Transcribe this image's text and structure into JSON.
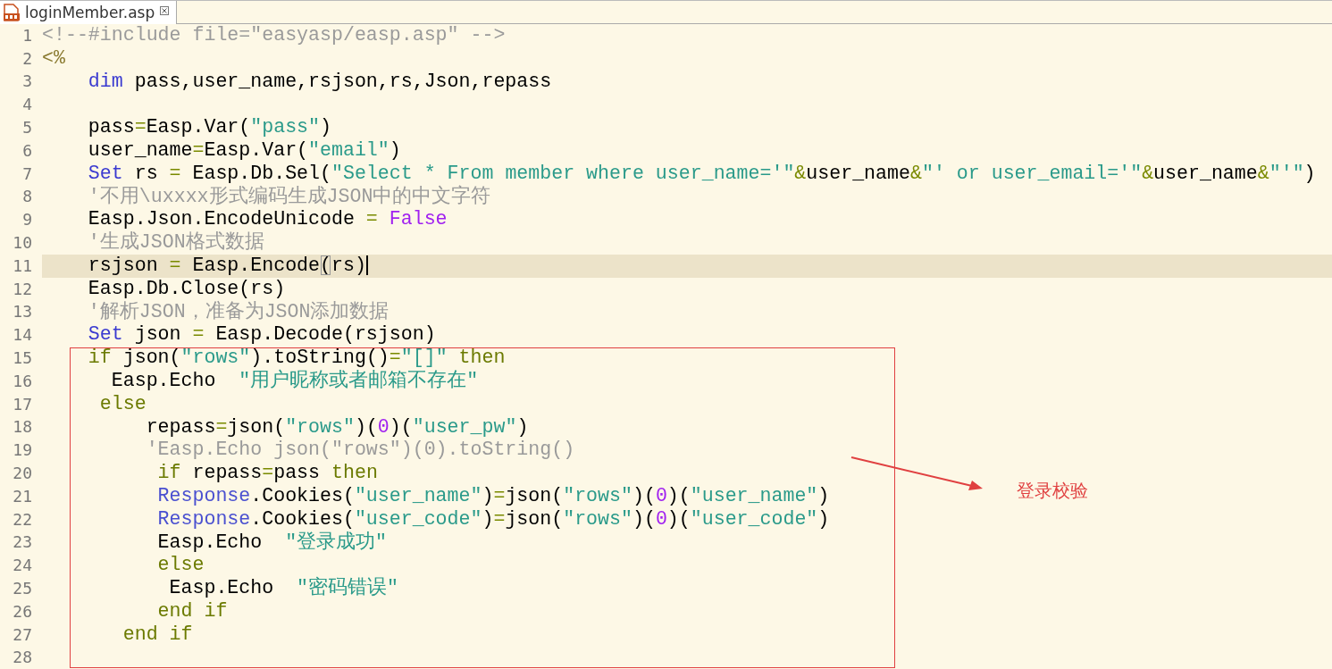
{
  "tabs": [
    {
      "label": "loginMember.asp",
      "selected": true
    }
  ],
  "lines": [
    {
      "number": "1",
      "current": false,
      "code": [
        {
          "text": "<!--#include file=\"easyasp/easp.asp\" -->",
          "kind": "comment"
        }
      ]
    },
    {
      "number": "2",
      "current": false,
      "code": [
        {
          "text": "<%",
          "kind": "tag"
        }
      ]
    },
    {
      "number": "3",
      "current": false,
      "code": [
        {
          "text": "    dim",
          "kind": "keyword"
        },
        {
          "text": " pass,user_name,rsjson,rs,Json,repass",
          "kind": "plain"
        }
      ]
    },
    {
      "number": "4",
      "current": false
    },
    {
      "number": "5",
      "current": false,
      "code": [
        {
          "text": "    pass",
          "kind": "plain"
        },
        {
          "text": "=",
          "kind": "operator"
        },
        {
          "text": "Easp.Var(",
          "kind": "plain"
        },
        {
          "text": "\"pass\"",
          "kind": "string"
        },
        {
          "text": ")",
          "kind": "plain"
        }
      ]
    },
    {
      "number": "6",
      "current": false,
      "code": [
        {
          "text": "    user_name",
          "kind": "plain"
        },
        {
          "text": "=",
          "kind": "operator"
        },
        {
          "text": "Easp.Var(",
          "kind": "plain"
        },
        {
          "text": "\"email\"",
          "kind": "string"
        },
        {
          "text": ")",
          "kind": "plain"
        }
      ]
    },
    {
      "number": "7",
      "current": false,
      "code": [
        {
          "text": "    Set",
          "kind": "keyword"
        },
        {
          "text": " rs ",
          "kind": "plain"
        },
        {
          "text": "=",
          "kind": "operator"
        },
        {
          "text": " Easp.Db.Sel(",
          "kind": "plain"
        },
        {
          "text": "\"Select * From member where user_name='\"",
          "kind": "string"
        },
        {
          "text": "&",
          "kind": "operator"
        },
        {
          "text": "user_name",
          "kind": "plain"
        },
        {
          "text": "&",
          "kind": "operator"
        },
        {
          "text": "\"' or user_email='\"",
          "kind": "string"
        },
        {
          "text": "&",
          "kind": "operator"
        },
        {
          "text": "user_name",
          "kind": "plain"
        },
        {
          "text": "&",
          "kind": "operator"
        },
        {
          "text": "\"'\"",
          "kind": "string"
        },
        {
          "text": ")",
          "kind": "plain"
        }
      ]
    },
    {
      "number": "8",
      "current": false,
      "code": [
        {
          "text": "    '不用\\uxxxx形式编码生成JSON中的中文字符",
          "kind": "comment"
        }
      ]
    },
    {
      "number": "9",
      "current": false,
      "code": [
        {
          "text": "    Easp.Json.EncodeUnicode ",
          "kind": "plain"
        },
        {
          "text": "=",
          "kind": "operator"
        },
        {
          "text": " False",
          "kind": "constant"
        }
      ]
    },
    {
      "number": "10",
      "current": false,
      "code": [
        {
          "text": "    '生成JSON格式数据",
          "kind": "comment"
        }
      ]
    },
    {
      "number": "11",
      "current": true,
      "code": [
        {
          "text": "    rsjson ",
          "kind": "plain"
        },
        {
          "text": "=",
          "kind": "operator"
        },
        {
          "text": " Easp.Encode",
          "kind": "plain"
        },
        {
          "text": "(",
          "kind": "match"
        },
        {
          "text": "rs)",
          "kind": "plain"
        }
      ]
    },
    {
      "number": "12",
      "current": false,
      "code": [
        {
          "text": "    Easp.Db.Close(rs)",
          "kind": "plain"
        }
      ]
    },
    {
      "number": "13",
      "current": false,
      "code": [
        {
          "text": "    '解析JSON，准备为JSON添加数据",
          "kind": "comment"
        }
      ]
    },
    {
      "number": "14",
      "current": false,
      "code": [
        {
          "text": "    Set",
          "kind": "keyword"
        },
        {
          "text": " json ",
          "kind": "plain"
        },
        {
          "text": "=",
          "kind": "operator"
        },
        {
          "text": " Easp.Decode(rsjson)",
          "kind": "plain"
        }
      ]
    },
    {
      "number": "15",
      "current": false,
      "code": [
        {
          "text": "    if",
          "kind": "control"
        },
        {
          "text": " json(",
          "kind": "plain"
        },
        {
          "text": "\"rows\"",
          "kind": "string"
        },
        {
          "text": ").toString()",
          "kind": "plain"
        },
        {
          "text": "=",
          "kind": "operator"
        },
        {
          "text": "\"[]\"",
          "kind": "string"
        },
        {
          "text": " then",
          "kind": "control"
        }
      ]
    },
    {
      "number": "16",
      "current": false,
      "code": [
        {
          "text": "      Easp.Echo  ",
          "kind": "plain"
        },
        {
          "text": "\"用户昵称或者邮箱不存在\"",
          "kind": "string"
        }
      ]
    },
    {
      "number": "17",
      "current": false,
      "code": [
        {
          "text": "     else",
          "kind": "control"
        }
      ]
    },
    {
      "number": "18",
      "current": false,
      "code": [
        {
          "text": "         repass",
          "kind": "plain"
        },
        {
          "text": "=",
          "kind": "operator"
        },
        {
          "text": "json(",
          "kind": "plain"
        },
        {
          "text": "\"rows\"",
          "kind": "string"
        },
        {
          "text": ")(",
          "kind": "plain"
        },
        {
          "text": "0",
          "kind": "number"
        },
        {
          "text": ")(",
          "kind": "plain"
        },
        {
          "text": "\"user_pw\"",
          "kind": "string"
        },
        {
          "text": ")",
          "kind": "plain"
        }
      ]
    },
    {
      "number": "19",
      "current": false,
      "code": [
        {
          "text": "         'Easp.Echo json(\"rows\")(0).toString()",
          "kind": "comment"
        }
      ]
    },
    {
      "number": "20",
      "current": false,
      "code": [
        {
          "text": "          if",
          "kind": "control"
        },
        {
          "text": " repass",
          "kind": "plain"
        },
        {
          "text": "=",
          "kind": "operator"
        },
        {
          "text": "pass",
          "kind": "plain"
        },
        {
          "text": " then",
          "kind": "control"
        }
      ]
    },
    {
      "number": "21",
      "current": false,
      "code": [
        {
          "text": "          Response",
          "kind": "object"
        },
        {
          "text": ".Cookies(",
          "kind": "plain"
        },
        {
          "text": "\"user_name\"",
          "kind": "string"
        },
        {
          "text": ")",
          "kind": "plain"
        },
        {
          "text": "=",
          "kind": "operator"
        },
        {
          "text": "json(",
          "kind": "plain"
        },
        {
          "text": "\"rows\"",
          "kind": "string"
        },
        {
          "text": ")(",
          "kind": "plain"
        },
        {
          "text": "0",
          "kind": "number"
        },
        {
          "text": ")(",
          "kind": "plain"
        },
        {
          "text": "\"user_name\"",
          "kind": "string"
        },
        {
          "text": ")",
          "kind": "plain"
        }
      ]
    },
    {
      "number": "22",
      "current": false,
      "code": [
        {
          "text": "          Response",
          "kind": "object"
        },
        {
          "text": ".Cookies(",
          "kind": "plain"
        },
        {
          "text": "\"user_code\"",
          "kind": "string"
        },
        {
          "text": ")",
          "kind": "plain"
        },
        {
          "text": "=",
          "kind": "operator"
        },
        {
          "text": "json(",
          "kind": "plain"
        },
        {
          "text": "\"rows\"",
          "kind": "string"
        },
        {
          "text": ")(",
          "kind": "plain"
        },
        {
          "text": "0",
          "kind": "number"
        },
        {
          "text": ")(",
          "kind": "plain"
        },
        {
          "text": "\"user_code\"",
          "kind": "string"
        },
        {
          "text": ")",
          "kind": "plain"
        }
      ]
    },
    {
      "number": "23",
      "current": false,
      "code": [
        {
          "text": "          Easp.Echo  ",
          "kind": "plain"
        },
        {
          "text": "\"登录成功\"",
          "kind": "string"
        }
      ]
    },
    {
      "number": "24",
      "current": false,
      "code": [
        {
          "text": "          else",
          "kind": "control"
        }
      ]
    },
    {
      "number": "25",
      "current": false,
      "code": [
        {
          "text": "           Easp.Echo  ",
          "kind": "plain"
        },
        {
          "text": "\"密码错误\"",
          "kind": "string"
        }
      ]
    },
    {
      "number": "26",
      "current": false,
      "code": [
        {
          "text": "          end if",
          "kind": "control"
        }
      ]
    },
    {
      "number": "27",
      "current": false,
      "code": [
        {
          "text": "       end if",
          "kind": "control"
        }
      ]
    },
    {
      "number": "28",
      "current": false
    }
  ],
  "annotation": {
    "label": "登录校验"
  }
}
